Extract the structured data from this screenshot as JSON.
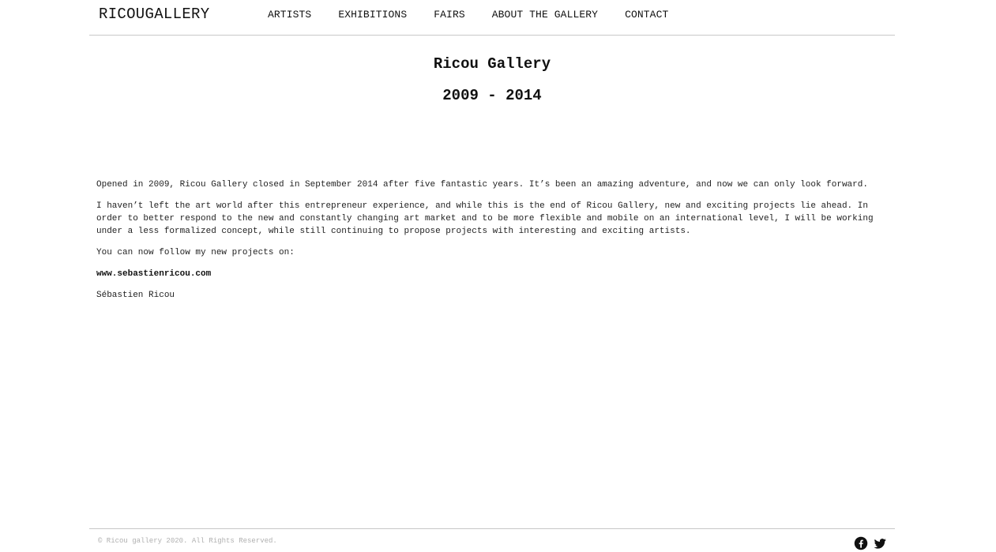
{
  "header": {
    "logo": "RICOUGALLERY",
    "nav": [
      "ARTISTS",
      "EXHIBITIONS",
      "FAIRS",
      "ABOUT THE GALLERY",
      "CONTACT"
    ]
  },
  "main": {
    "title": "Ricou Gallery",
    "years": "2009 - 2014",
    "paragraphs": [
      "Opened in 2009, Ricou Gallery closed in September 2014 after five fantastic years. It’s been an amazing adventure, and now we can only look forward.",
      "I haven’t left the art world after this entrepreneur experience, and while this is the end of Ricou Gallery, new and exciting projects lie ahead. In order to better respond to the new and constantly changing art market and to be more flexible and mobile on an international level, I will be working under a less formalized concept, while still continuing to propose projects with interesting and exciting artists.",
      "You can now follow my new projects on:"
    ],
    "link": "www.sebastienricou.com",
    "signature": "Sébastien Ricou"
  },
  "footer": {
    "copyright": "© Ricou gallery 2020. All Rights Reserved.",
    "social": [
      "facebook-icon",
      "twitter-icon"
    ]
  }
}
